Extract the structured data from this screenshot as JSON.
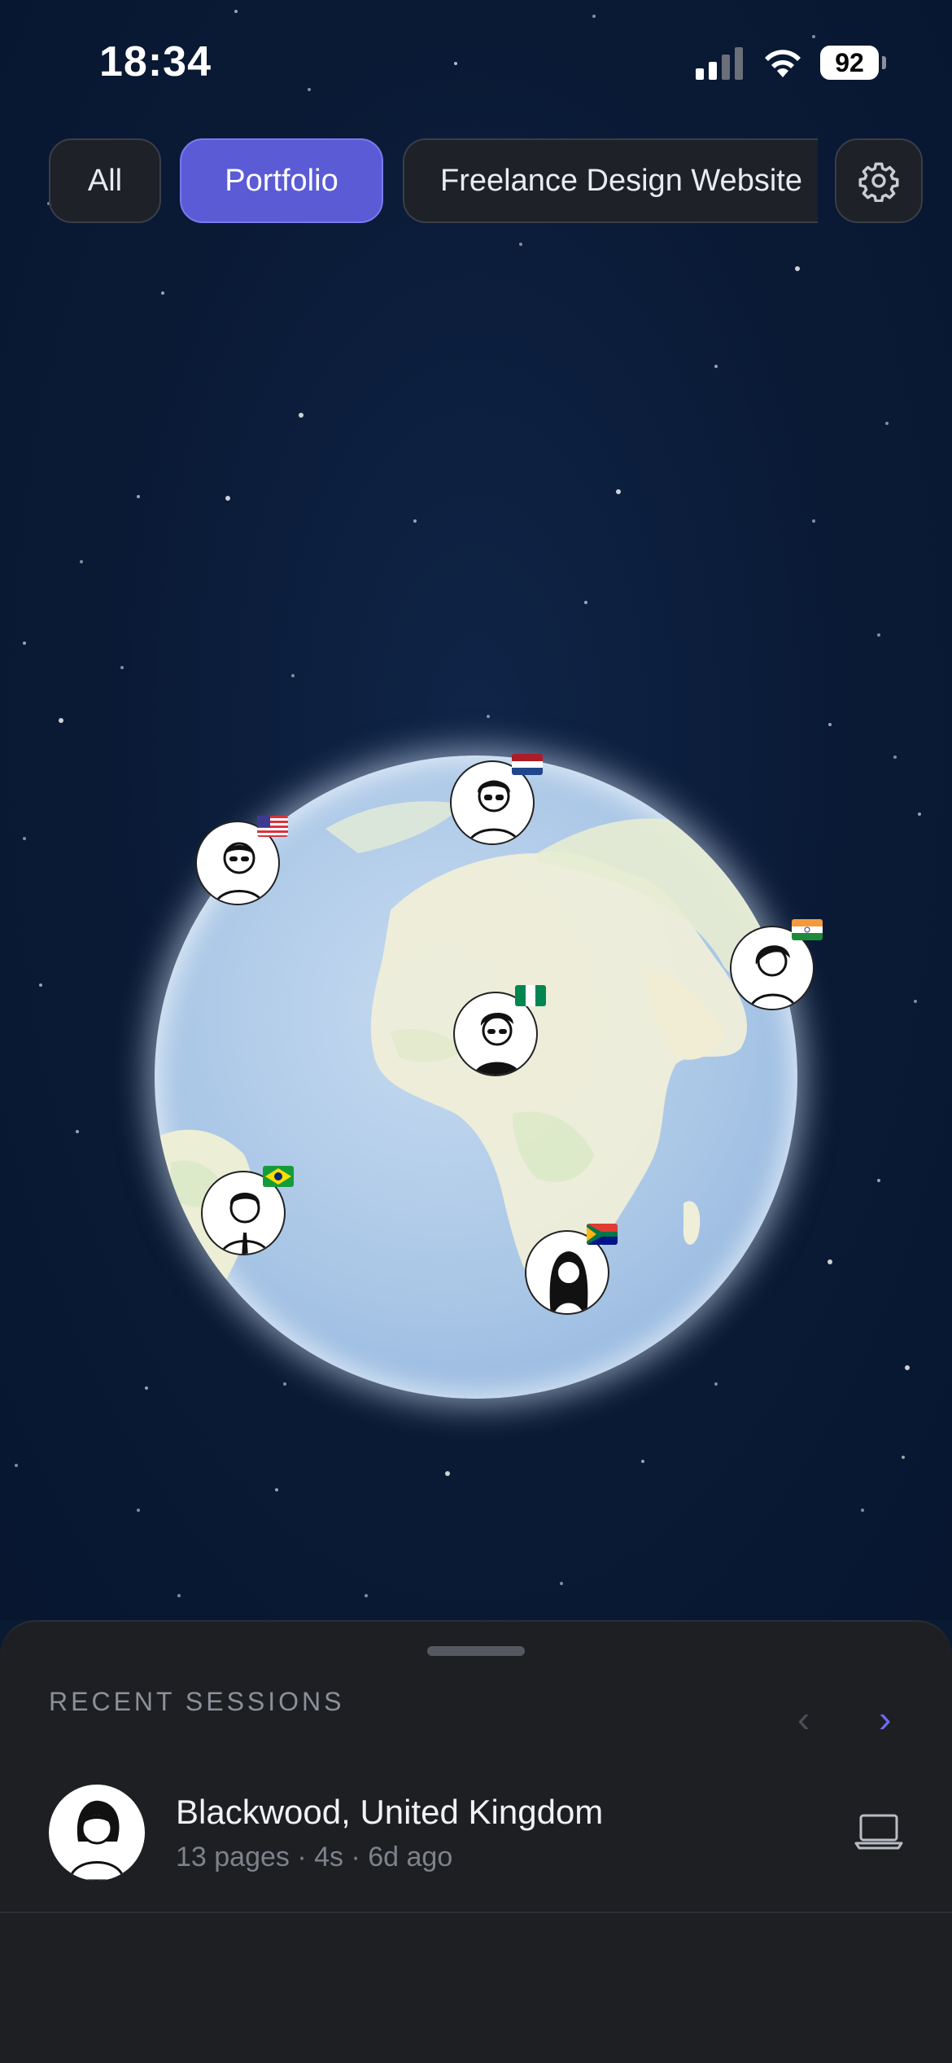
{
  "status_bar": {
    "time": "18:34",
    "battery_level": "92"
  },
  "filters": {
    "chips": [
      {
        "label": "All",
        "selected": false
      },
      {
        "label": "Portfolio",
        "selected": true
      },
      {
        "label": "Freelance Design Website",
        "selected": false
      }
    ],
    "settings_icon": "gear-icon"
  },
  "globe": {
    "markers": [
      {
        "name": "marker-usa",
        "flag": "us-flag"
      },
      {
        "name": "marker-netherlands",
        "flag": "nl-flag"
      },
      {
        "name": "marker-india",
        "flag": "in-flag"
      },
      {
        "name": "marker-nigeria",
        "flag": "ng-flag"
      },
      {
        "name": "marker-brazil",
        "flag": "br-flag"
      },
      {
        "name": "marker-south-africa",
        "flag": "za-flag"
      }
    ]
  },
  "recent_sessions": {
    "title": "RECENT SESSIONS",
    "prev_icon": "chevron-left-icon",
    "next_icon": "chevron-right-icon",
    "items": [
      {
        "location": "Blackwood, United Kingdom",
        "meta": "13 pages · 4s · 6d ago",
        "device_icon": "laptop-icon"
      }
    ]
  },
  "colors": {
    "accent": "#5b5bd6",
    "background": "#0a1a33",
    "sheet": "#1d1f23"
  }
}
